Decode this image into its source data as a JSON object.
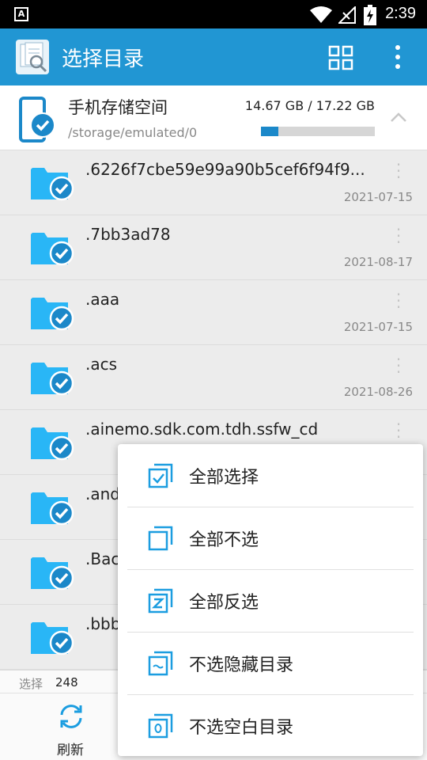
{
  "status_bar": {
    "time": "2:39",
    "left_icon_letter": "A"
  },
  "app_bar": {
    "title": "选择目录"
  },
  "storage": {
    "name": "手机存储空间",
    "path": "/storage/emulated/0",
    "usage": "14.67 GB / 17.22 GB",
    "used_fraction": 0.15
  },
  "folders": [
    {
      "name": ".6226f7cbe59e99a90b5cef6f94f9...",
      "date": "2021-07-15"
    },
    {
      "name": ".7bb3ad78",
      "date": "2021-08-17"
    },
    {
      "name": ".aaa",
      "date": "2021-07-15"
    },
    {
      "name": ".acs",
      "date": "2021-08-26"
    },
    {
      "name": ".ainemo.sdk.com.tdh.ssfw_cd",
      "date": ""
    },
    {
      "name": ".and",
      "date": ""
    },
    {
      "name": ".Bac",
      "date": ""
    },
    {
      "name": ".bbb",
      "date": ""
    }
  ],
  "footer": {
    "selected_label": "选择",
    "selected_count": "248",
    "refresh_label": "刷新"
  },
  "menu": {
    "items": [
      {
        "label": "全部选择",
        "icon": "select-all-icon"
      },
      {
        "label": "全部不选",
        "icon": "select-none-icon"
      },
      {
        "label": "全部反选",
        "icon": "invert-selection-icon"
      },
      {
        "label": "不选隐藏目录",
        "icon": "hidden-folder-icon"
      },
      {
        "label": "不选空白目录",
        "icon": "empty-folder-icon"
      }
    ]
  },
  "colors": {
    "primary": "#2196d3",
    "accent": "#1b88c9",
    "folder": "#29b6f6"
  }
}
